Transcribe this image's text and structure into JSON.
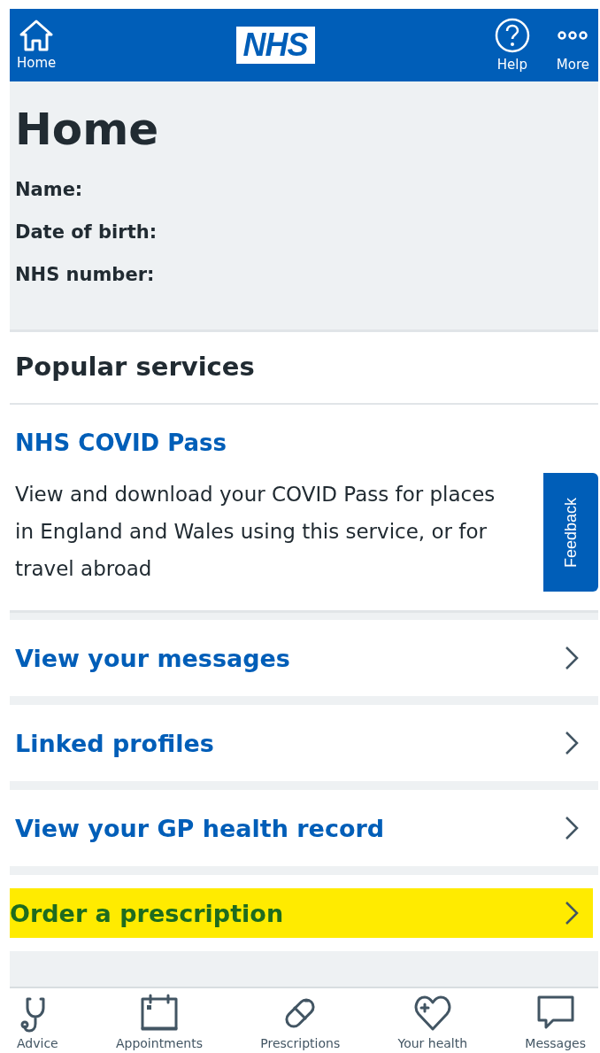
{
  "header": {
    "home": "Home",
    "logo": "NHS",
    "help": "Help",
    "more": "More"
  },
  "page": {
    "title": "Home",
    "details": [
      {
        "label": "Name:"
      },
      {
        "label": "Date of birth:"
      },
      {
        "label": "NHS number:"
      }
    ]
  },
  "popular": {
    "heading": "Popular services",
    "card": {
      "title": "NHS COVID Pass",
      "text": "View and download your COVID Pass for places in England and Wales using this service, or for travel abroad"
    }
  },
  "links": [
    {
      "label": "View your messages",
      "highlighted": false
    },
    {
      "label": "Linked profiles",
      "highlighted": false
    },
    {
      "label": "View your GP health record",
      "highlighted": false
    },
    {
      "label": "Order a prescription",
      "highlighted": true
    }
  ],
  "feedback": "Feedback",
  "nav": [
    {
      "kind": "advice",
      "label": "Advice"
    },
    {
      "kind": "appointments",
      "label": "Appointments"
    },
    {
      "kind": "prescriptions",
      "label": "Prescriptions"
    },
    {
      "kind": "health",
      "label": "Your health"
    },
    {
      "kind": "messages",
      "label": "Messages"
    }
  ]
}
